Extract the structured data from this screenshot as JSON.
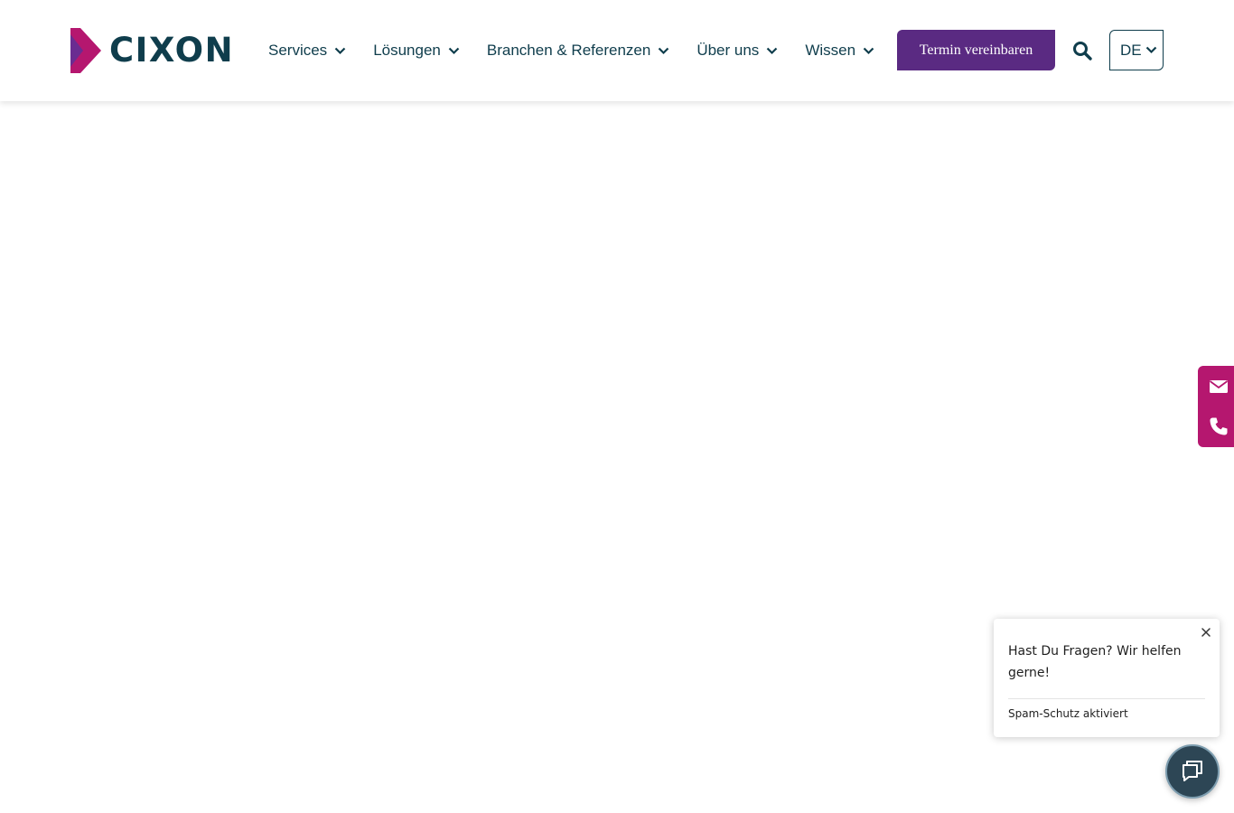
{
  "brand": {
    "logo_text": "CIXON",
    "colors": {
      "primary": "#0f3d4c",
      "accent_purple": "#5a2a82",
      "accent_magenta": "#b5176f",
      "chat_button": "#2d4655"
    }
  },
  "nav": {
    "items": [
      {
        "label": "Services"
      },
      {
        "label": "Lösungen"
      },
      {
        "label": "Branchen & Referenzen"
      },
      {
        "label": "Über uns"
      },
      {
        "label": "Wissen"
      }
    ],
    "cta_label": "Termin vereinbaren",
    "search_icon": "search-icon",
    "language": "DE"
  },
  "contact_tab": {
    "icons": [
      "envelope-icon",
      "phone-icon"
    ]
  },
  "chat": {
    "message": "Hast Du Fragen? Wir helfen gerne!",
    "spam_note": "Spam-Schutz aktiviert",
    "launcher_icon": "chat-bubble-icon",
    "close_icon": "close-icon"
  }
}
